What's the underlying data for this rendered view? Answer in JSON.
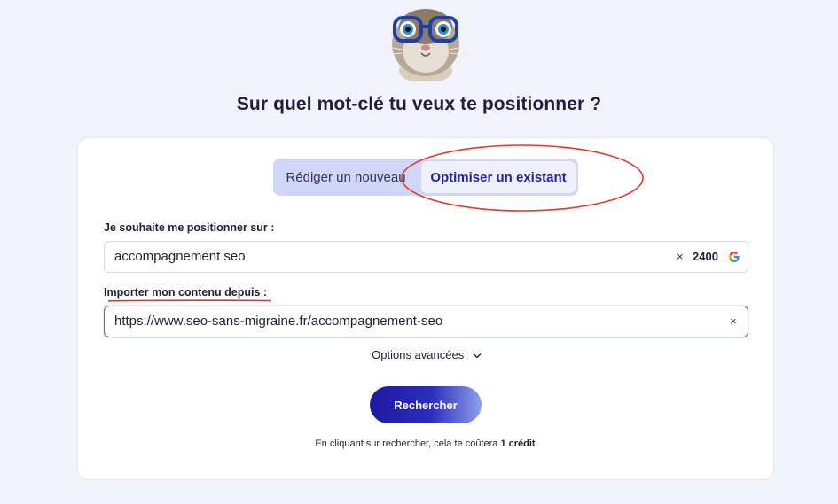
{
  "page": {
    "title": "Sur quel mot-clé tu veux te positionner ?"
  },
  "tabs": {
    "new_label": "Rédiger un nouveau",
    "existing_label": "Optimiser un existant",
    "active": "existing"
  },
  "keyword": {
    "label": "Je souhaite me positionner sur :",
    "value": "accompagnement seo",
    "clear_glyph": "×",
    "search_volume": "2400",
    "volume_icon": "google-icon"
  },
  "import": {
    "label": "Importer mon contenu depuis :",
    "value": "https://www.seo-sans-migraine.fr/accompagnement-seo",
    "clear_glyph": "×"
  },
  "advanced": {
    "label": "Options avancées",
    "icon": "chevron-down-icon"
  },
  "search_button": {
    "label": "Rechercher"
  },
  "note": {
    "prefix": "En cliquant sur rechercher, cela te coûtera ",
    "credit": "1 crédit",
    "suffix": "."
  },
  "annotations": {
    "ellipse_color": "#e0392b",
    "underline_color": "#e0392b"
  },
  "colors": {
    "background": "#f0f2fc",
    "accent": "#22239a",
    "toggle_bg": "#cfd6f7"
  }
}
